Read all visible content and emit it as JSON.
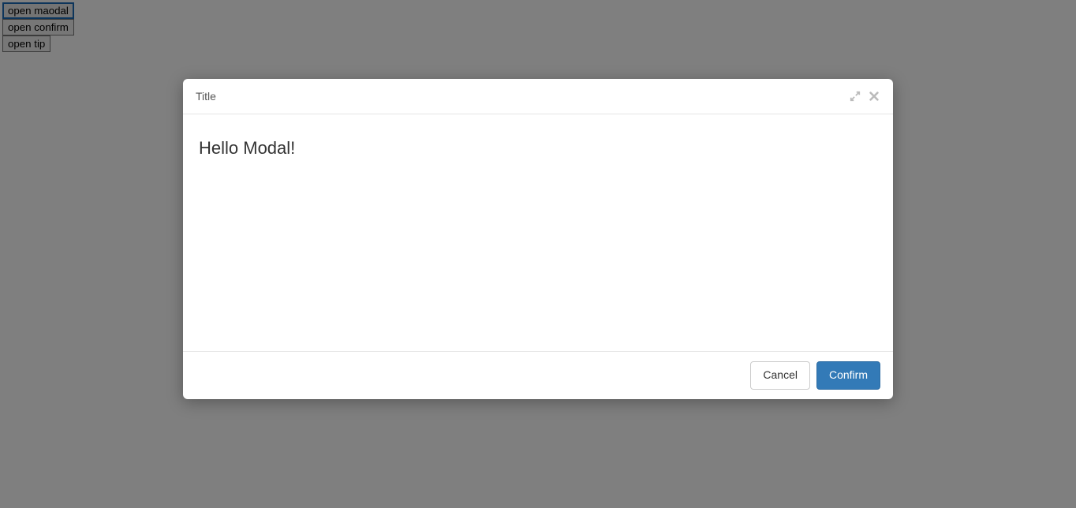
{
  "page": {
    "buttons": {
      "open_modal": "open maodal",
      "open_confirm": "open confirm",
      "open_tip": "open tip"
    }
  },
  "modal": {
    "title": "Title",
    "body": "Hello Modal!",
    "footer": {
      "cancel": "Cancel",
      "confirm": "Confirm"
    }
  }
}
